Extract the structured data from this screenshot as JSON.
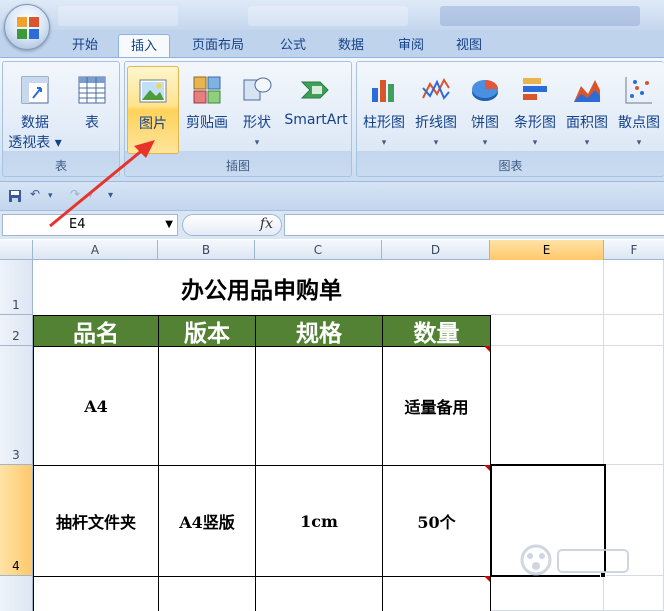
{
  "ribbon": {
    "tabs": [
      {
        "label": "开始"
      },
      {
        "label": "插入"
      },
      {
        "label": "页面布局"
      },
      {
        "label": "公式"
      },
      {
        "label": "数据"
      },
      {
        "label": "审阅"
      },
      {
        "label": "视图"
      }
    ],
    "active_tab": "插入",
    "groups": {
      "tables": {
        "label": "表",
        "pivot_line1": "数据",
        "pivot_line2": "透视表",
        "table": "表"
      },
      "illustrations": {
        "label": "插图",
        "picture": "图片",
        "clipart": "剪贴画",
        "shapes": "形状",
        "smartart": "SmartArt"
      },
      "charts": {
        "label": "图表",
        "column": "柱形图",
        "line": "折线图",
        "pie": "饼图",
        "bar": "条形图",
        "area": "面积图",
        "scatter": "散点图"
      }
    }
  },
  "formula_bar": {
    "name_box": "E4",
    "fx": "fx",
    "content": ""
  },
  "grid": {
    "columns": [
      "A",
      "B",
      "C",
      "D",
      "E",
      "F"
    ],
    "rows": [
      "1",
      "2",
      "3",
      "4"
    ],
    "title": "办公用品申购单",
    "headers": [
      "品名",
      "版本",
      "规格",
      "数量"
    ],
    "data": [
      [
        "A4",
        "",
        "",
        "适量备用"
      ],
      [
        "抽杆文件夹",
        "A4竖版",
        "1cm",
        "50个"
      ]
    ],
    "selected_cell": "E4"
  },
  "colors": {
    "header_fill": "#548235",
    "accent": "#15428b",
    "selection_header": "#ffc86b"
  }
}
